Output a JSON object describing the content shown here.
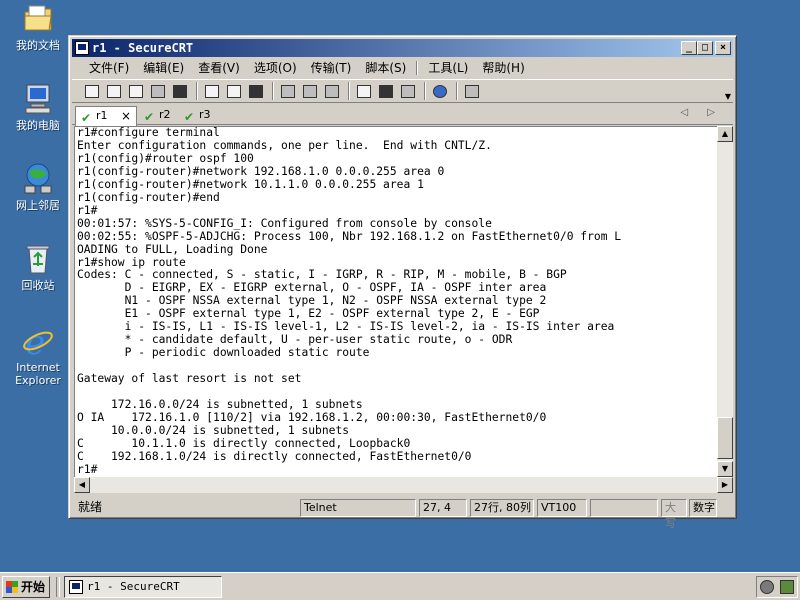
{
  "desktop": {
    "icons": [
      {
        "label": "我的文档",
        "icon": "my-documents-icon"
      },
      {
        "label": "我的电脑",
        "icon": "my-computer-icon"
      },
      {
        "label": "网上邻居",
        "icon": "network-places-icon"
      },
      {
        "label": "回收站",
        "icon": "recycle-bin-icon"
      },
      {
        "label": "Internet Explorer",
        "icon": "internet-explorer-icon"
      }
    ]
  },
  "window": {
    "title": "r1 - SecureCRT",
    "controls": {
      "minimize": "_",
      "maximize": "□",
      "close": "×"
    },
    "menu": [
      "文件(F)",
      "编辑(E)",
      "查看(V)",
      "选项(O)",
      "传输(T)",
      "脚本(S)",
      "工具(L)",
      "帮助(H)"
    ],
    "tabs": [
      {
        "label": "r1",
        "close": "×"
      },
      {
        "label": "r2"
      },
      {
        "label": "r3"
      }
    ],
    "tab_nav": "◁ ▷",
    "terminal_text": "r1#configure terminal\nEnter configuration commands, one per line.  End with CNTL/Z.\nr1(config)#router ospf 100\nr1(config-router)#network 192.168.1.0 0.0.0.255 area 0\nr1(config-router)#network 10.1.1.0 0.0.0.255 area 1\nr1(config-router)#end\nr1#\n00:01:57: %SYS-5-CONFIG_I: Configured from console by console\n00:02:55: %OSPF-5-ADJCHG: Process 100, Nbr 192.168.1.2 on FastEthernet0/0 from L\nOADING to FULL, Loading Done\nr1#show ip route\nCodes: C - connected, S - static, I - IGRP, R - RIP, M - mobile, B - BGP\n       D - EIGRP, EX - EIGRP external, O - OSPF, IA - OSPF inter area\n       N1 - OSPF NSSA external type 1, N2 - OSPF NSSA external type 2\n       E1 - OSPF external type 1, E2 - OSPF external type 2, E - EGP\n       i - IS-IS, L1 - IS-IS level-1, L2 - IS-IS level-2, ia - IS-IS inter area\n       * - candidate default, U - per-user static route, o - ODR\n       P - periodic downloaded static route\n\nGateway of last resort is not set\n\n     172.16.0.0/24 is subnetted, 1 subnets\nO IA    172.16.1.0 [110/2] via 192.168.1.2, 00:00:30, FastEthernet0/0\n     10.0.0.0/24 is subnetted, 1 subnets\nC       10.1.1.0 is directly connected, Loopback0\nC    192.168.1.0/24 is directly connected, FastEthernet0/0\nr1#",
    "scroll": {
      "up": "▲",
      "down": "▼",
      "left": "◀",
      "right": "▶"
    },
    "status": {
      "ready": "就绪",
      "protocol": "Telnet",
      "cursor": "27,  4",
      "size": "27行, 80列",
      "emulation": "VT100",
      "blank": "",
      "caps": "大写",
      "num": "数字"
    }
  },
  "taskbar": {
    "start_label": "开始",
    "task_label": "r1 - SecureCRT"
  }
}
